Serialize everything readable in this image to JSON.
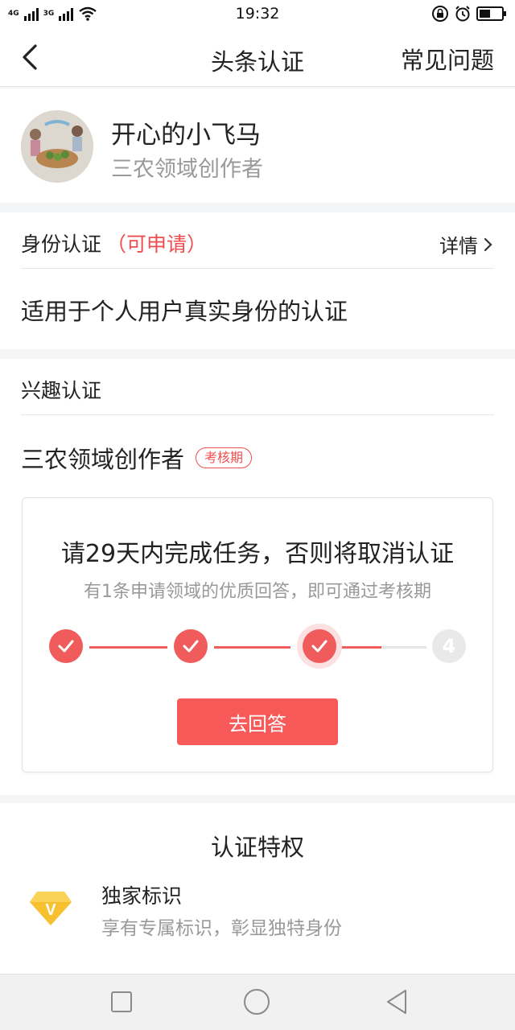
{
  "status_bar": {
    "network_1": "4G",
    "network_2": "3G",
    "time": "19:32"
  },
  "navbar": {
    "title": "头条认证",
    "faq_label": "常见问题"
  },
  "profile": {
    "name": "开心的小飞马",
    "role": "三农领域创作者"
  },
  "identity_section": {
    "title": "身份认证",
    "status": "（可申请）",
    "detail_label": "详情",
    "description": "适用于个人用户真实身份的认证"
  },
  "interest_section": {
    "title": "兴趣认证",
    "field_name": "三农领域创作者",
    "badge": "考核期",
    "task": {
      "title": "请29天内完成任务，否则将取消认证",
      "subtitle": "有1条申请领域的优质回答，即可通过考核期",
      "steps": [
        {
          "state": "done"
        },
        {
          "state": "done"
        },
        {
          "state": "current"
        },
        {
          "state": "todo",
          "label": "4"
        }
      ],
      "progress_between_3_and_4": 0.5,
      "button_label": "去回答"
    }
  },
  "privileges": {
    "title": "认证特权",
    "items": [
      {
        "icon": "diamond-v-icon",
        "name": "独家标识",
        "desc": "享有专属标识，彰显独特身份"
      }
    ]
  },
  "colors": {
    "accent": "#f85959",
    "muted_text": "#999999",
    "divider": "#e6e6e6"
  }
}
